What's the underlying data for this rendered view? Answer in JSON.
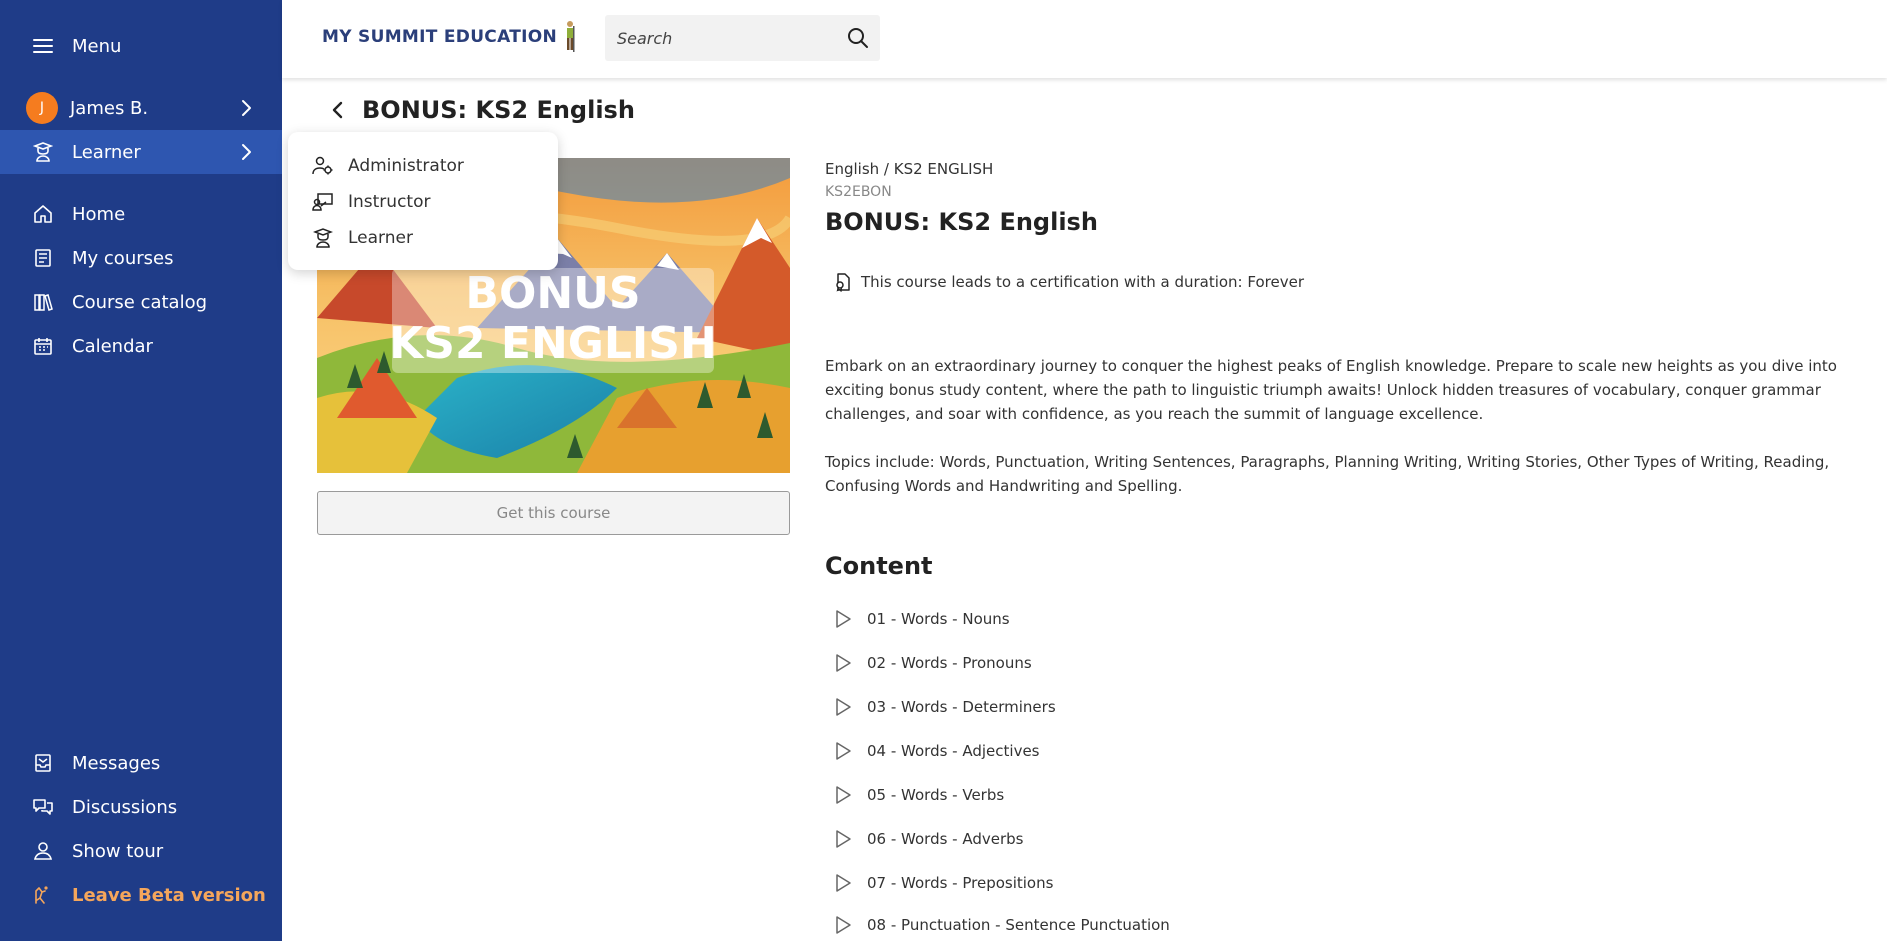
{
  "sidebar": {
    "menu_label": "Menu",
    "user": {
      "initial": "J",
      "name": "James B."
    },
    "role": "Learner",
    "nav": [
      {
        "label": "Home",
        "icon": "home-icon"
      },
      {
        "label": "My courses",
        "icon": "book-icon"
      },
      {
        "label": "Course catalog",
        "icon": "library-icon"
      },
      {
        "label": "Calendar",
        "icon": "calendar-icon"
      }
    ],
    "bottom": [
      {
        "label": "Messages",
        "icon": "inbox-icon"
      },
      {
        "label": "Discussions",
        "icon": "chat-icon"
      },
      {
        "label": "Show tour",
        "icon": "tour-icon"
      },
      {
        "label": "Leave Beta version",
        "icon": "beta-icon"
      }
    ],
    "colors": {
      "background": "#1f3c88",
      "active": "#2e56b0",
      "avatar": "#f57c1f",
      "beta": "#f5a65b"
    }
  },
  "topbar": {
    "logo_text": "MY SUMMIT EDUCATION",
    "search_placeholder": "Search"
  },
  "role_dropdown": {
    "items": [
      "Administrator",
      "Instructor",
      "Learner"
    ]
  },
  "page": {
    "title": "BONUS: KS2 English"
  },
  "course": {
    "image_text_line1": "BONUS",
    "image_text_line2": "KS2 ENGLISH",
    "get_button": "Get this course",
    "breadcrumb": "English / KS2 ENGLISH",
    "code": "KS2EBON",
    "title": "BONUS: KS2 English",
    "certification": "This course leads to a certification with a duration: Forever",
    "description_1": "Embark on an extraordinary journey to conquer the highest peaks of English knowledge. Prepare to scale new heights as you dive into exciting bonus study content, where the path to linguistic triumph awaits! Unlock hidden treasures of vocabulary, conquer grammar challenges, and soar with confidence, as you reach the summit of language excellence.",
    "description_2": "Topics include: Words, Punctuation, Writing Sentences, Paragraphs, Planning Writing, Writing Stories, Other Types of Writing, Reading, Confusing Words and Handwriting and Spelling.",
    "content_heading": "Content",
    "lessons": [
      "01 - Words - Nouns",
      "02 - Words - Pronouns",
      "03 - Words - Determiners",
      "04 - Words - Adjectives",
      "05 - Words - Verbs",
      "06 - Words - Adverbs",
      "07 - Words - Prepositions",
      "08 - Punctuation - Sentence Punctuation"
    ]
  }
}
